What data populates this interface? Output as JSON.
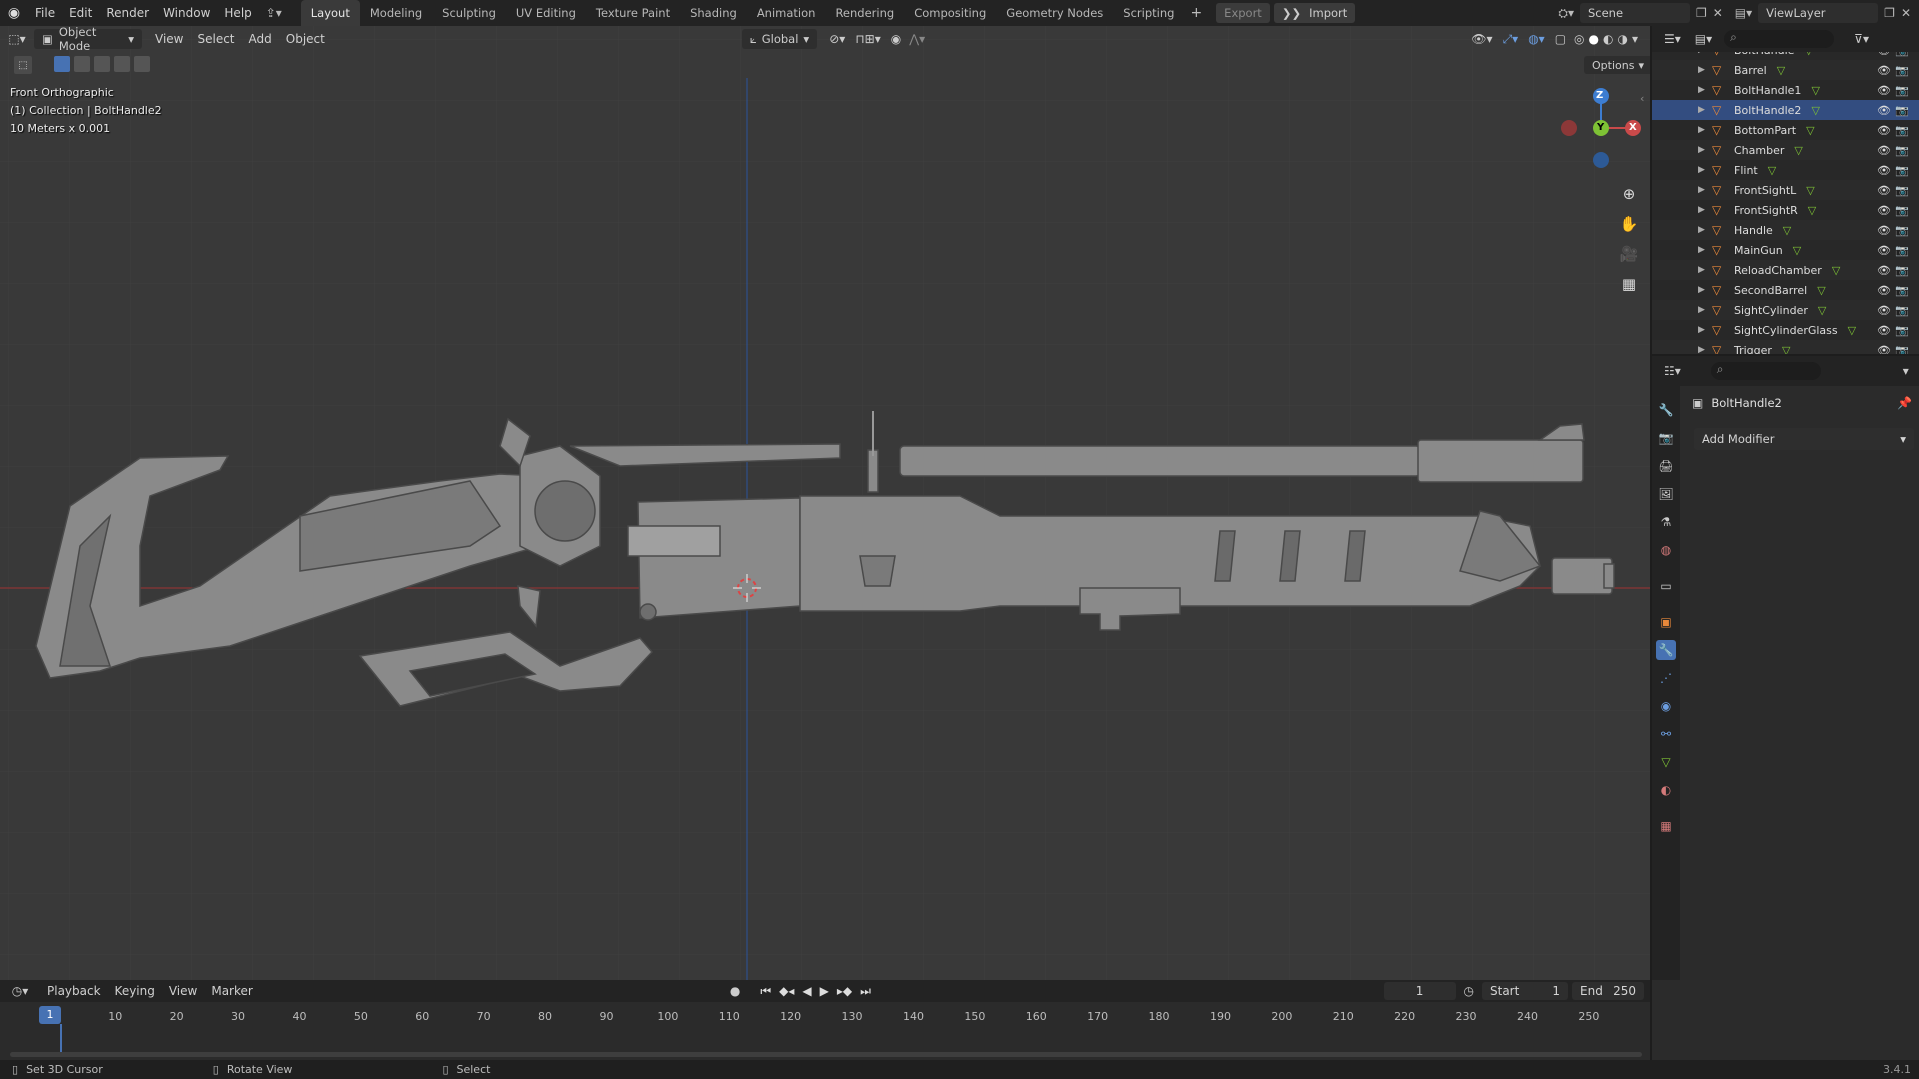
{
  "menu": [
    "File",
    "Edit",
    "Render",
    "Window",
    "Help"
  ],
  "workspaces": [
    "Layout",
    "Modeling",
    "Sculpting",
    "UV Editing",
    "Texture Paint",
    "Shading",
    "Animation",
    "Rendering",
    "Compositing",
    "Geometry Nodes",
    "Scripting"
  ],
  "active_workspace": "Layout",
  "topbar": {
    "export": "Export",
    "import": "Import",
    "scene": "Scene",
    "view_layer": "ViewLayer"
  },
  "viewport_header": {
    "mode": "Object Mode",
    "menus": [
      "View",
      "Select",
      "Add",
      "Object"
    ],
    "transform": "Global",
    "options": "Options"
  },
  "viewport_overlay": {
    "view_name": "Front Orthographic",
    "collection": "(1) Collection | BoltHandle2",
    "scale": "10 Meters x 0.001"
  },
  "gizmo": {
    "z": "Z",
    "y": "Y",
    "x": "X"
  },
  "outliner": {
    "items": [
      "BoltHandle",
      "Barrel",
      "BoltHandle1",
      "BoltHandle2",
      "BottomPart",
      "Chamber",
      "Flint",
      "FrontSightL",
      "FrontSightR",
      "Handle",
      "MainGun",
      "ReloadChamber",
      "SecondBarrel",
      "SightCylinder",
      "SightCylinderGlass",
      "Trigger"
    ],
    "selected": "BoltHandle2"
  },
  "properties": {
    "object_name": "BoltHandle2",
    "add_modifier": "Add Modifier"
  },
  "timeline": {
    "menus": [
      "Playback",
      "Keying",
      "View",
      "Marker"
    ],
    "current_frame": "1",
    "start_label": "Start",
    "start": "1",
    "end_label": "End",
    "end": "250",
    "ticks": [
      "1",
      "10",
      "20",
      "30",
      "40",
      "50",
      "60",
      "70",
      "80",
      "90",
      "100",
      "110",
      "120",
      "130",
      "140",
      "150",
      "160",
      "170",
      "180",
      "190",
      "200",
      "210",
      "220",
      "230",
      "240",
      "250"
    ]
  },
  "statusbar": {
    "left": "Set 3D Cursor",
    "middle": "Rotate View",
    "right": "Select",
    "version": "3.4.1"
  },
  "colors": {
    "accent": "#4772b3",
    "axis_x": "#c94a4a",
    "axis_y": "#7ec235",
    "axis_z": "#3d7dd1",
    "mesh": "#8a8a8a",
    "object_icon": "#e8883a"
  }
}
